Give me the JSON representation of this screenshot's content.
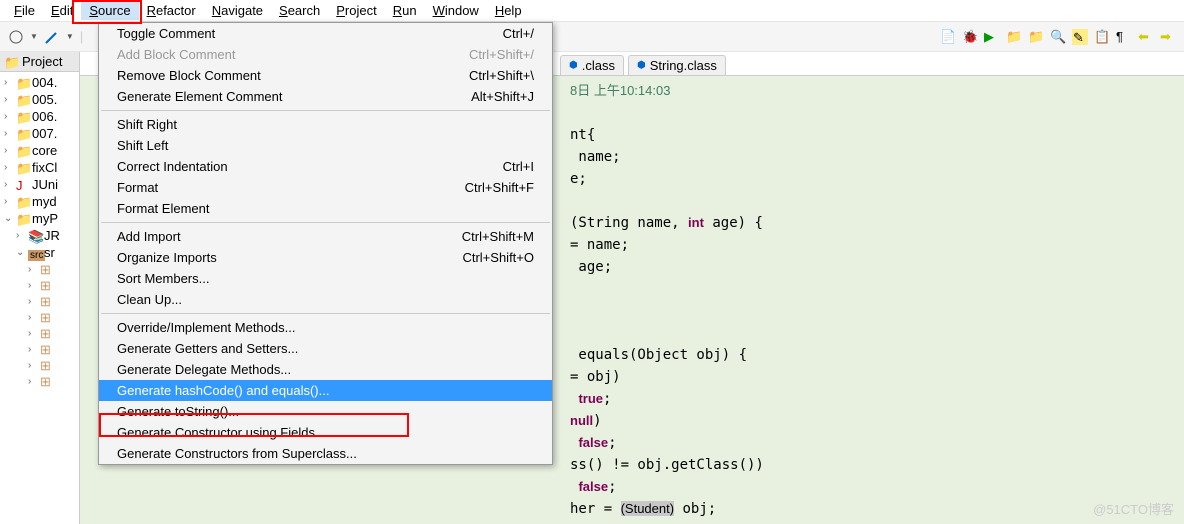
{
  "menubar": {
    "items": [
      "File",
      "Edit",
      "Source",
      "Refactor",
      "Navigate",
      "Search",
      "Project",
      "Run",
      "Window",
      "Help"
    ],
    "active": 2
  },
  "sidebar": {
    "header": "Project",
    "nodes": [
      {
        "icon": "folder",
        "label": "004.",
        "arrow": ">"
      },
      {
        "icon": "folder",
        "label": "005.",
        "arrow": ">"
      },
      {
        "icon": "folder",
        "label": "006.",
        "arrow": ">"
      },
      {
        "icon": "folder",
        "label": "007.",
        "arrow": ">"
      },
      {
        "icon": "folder",
        "label": "core",
        "arrow": ">"
      },
      {
        "icon": "folder",
        "label": "fixCl",
        "arrow": ">"
      },
      {
        "icon": "junit",
        "label": "JUni",
        "arrow": ">"
      },
      {
        "icon": "folder",
        "label": "myd",
        "arrow": ">"
      },
      {
        "icon": "folder",
        "label": "myP",
        "arrow": "v",
        "open": true
      },
      {
        "icon": "lib",
        "label": "JR",
        "arrow": ">",
        "indent": 1
      },
      {
        "icon": "src",
        "label": "sr",
        "arrow": "v",
        "indent": 1,
        "open": true
      }
    ],
    "pkg_rows": 8
  },
  "tabs": [
    {
      "label": ".class",
      "icon": "class-file"
    },
    {
      "label": "String.class",
      "icon": "class-file"
    }
  ],
  "code": {
    "timestamp": "8日 上午10:14:03",
    "lines": [
      "",
      "nt{",
      " name;",
      "e;",
      "",
      "(String name, <kw>int</kw> age) {",
      "= name;",
      " age;",
      "",
      "",
      "",
      " equals(Object obj) {",
      "= obj)",
      " <kw>true</kw>;",
      "<kw>null</kw>)",
      " <kw>false</kw>;",
      "ss() != obj.getClass())",
      " <kw>false</kw>;",
      "her = <hl>(Student)</hl> obj;"
    ]
  },
  "dropdown": {
    "groups": [
      [
        {
          "label": "Toggle Comment",
          "shortcut": "Ctrl+/"
        },
        {
          "label": "Add Block Comment",
          "shortcut": "Ctrl+Shift+/",
          "disabled": true
        },
        {
          "label": "Remove Block Comment",
          "shortcut": "Ctrl+Shift+\\"
        },
        {
          "label": "Generate Element Comment",
          "shortcut": "Alt+Shift+J"
        }
      ],
      [
        {
          "label": "Shift Right",
          "shortcut": ""
        },
        {
          "label": "Shift Left",
          "shortcut": ""
        },
        {
          "label": "Correct Indentation",
          "shortcut": "Ctrl+I"
        },
        {
          "label": "Format",
          "shortcut": "Ctrl+Shift+F"
        },
        {
          "label": "Format Element",
          "shortcut": ""
        }
      ],
      [
        {
          "label": "Add Import",
          "shortcut": "Ctrl+Shift+M"
        },
        {
          "label": "Organize Imports",
          "shortcut": "Ctrl+Shift+O"
        },
        {
          "label": "Sort Members...",
          "shortcut": ""
        },
        {
          "label": "Clean Up...",
          "shortcut": ""
        }
      ],
      [
        {
          "label": "Override/Implement Methods...",
          "shortcut": ""
        },
        {
          "label": "Generate Getters and Setters...",
          "shortcut": ""
        },
        {
          "label": "Generate Delegate Methods...",
          "shortcut": ""
        },
        {
          "label": "Generate hashCode() and equals()...",
          "shortcut": "",
          "highlighted": true
        },
        {
          "label": "Generate toString()...",
          "shortcut": ""
        },
        {
          "label": "Generate Constructor using Fields...",
          "shortcut": ""
        },
        {
          "label": "Generate Constructors from Superclass...",
          "shortcut": ""
        }
      ]
    ]
  },
  "watermark": "@51CTO博客"
}
